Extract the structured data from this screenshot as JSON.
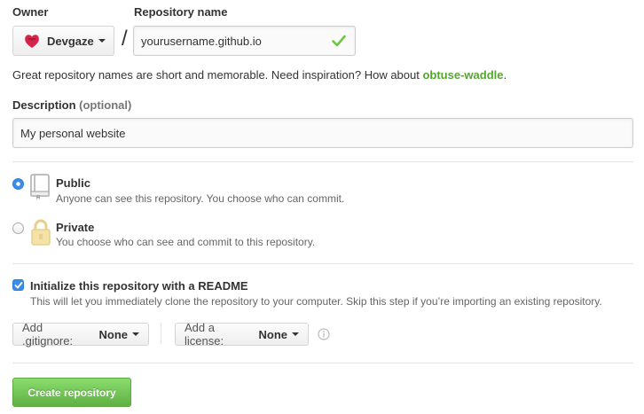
{
  "owner": {
    "label": "Owner",
    "selected": "Devgaze"
  },
  "repository": {
    "label": "Repository name",
    "separator": "/",
    "value": "yourusername.github.io",
    "valid": true
  },
  "hint": {
    "text": "Great repository names are short and memorable. Need inspiration? How about ",
    "suggestion": "obtuse-waddle",
    "end": "."
  },
  "description": {
    "label": "Description",
    "optional": "(optional)",
    "value": "My personal website"
  },
  "visibility": {
    "selected": "public",
    "public": {
      "title": "Public",
      "note": "Anyone can see this repository. You choose who can commit."
    },
    "private": {
      "title": "Private",
      "note": "You choose who can see and commit to this repository."
    }
  },
  "readme": {
    "checked": true,
    "title": "Initialize this repository with a README",
    "note": "This will let you immediately clone the repository to your computer. Skip this step if you’re importing an existing repository."
  },
  "gitignore": {
    "label": "Add .gitignore:",
    "value": "None"
  },
  "license": {
    "label": "Add a license:",
    "value": "None"
  },
  "submit": {
    "label": "Create repository"
  },
  "colors": {
    "accent_green": "#55a532",
    "button_green": "#60b044",
    "radio_blue": "#3b8de8",
    "check_green": "#6cc644",
    "avatar_red": "#d6254b"
  },
  "icons": {
    "owner_avatar": "devgaze-avatar",
    "valid": "check-icon",
    "public": "repo-book-icon",
    "private": "lock-icon",
    "info": "info-icon"
  }
}
